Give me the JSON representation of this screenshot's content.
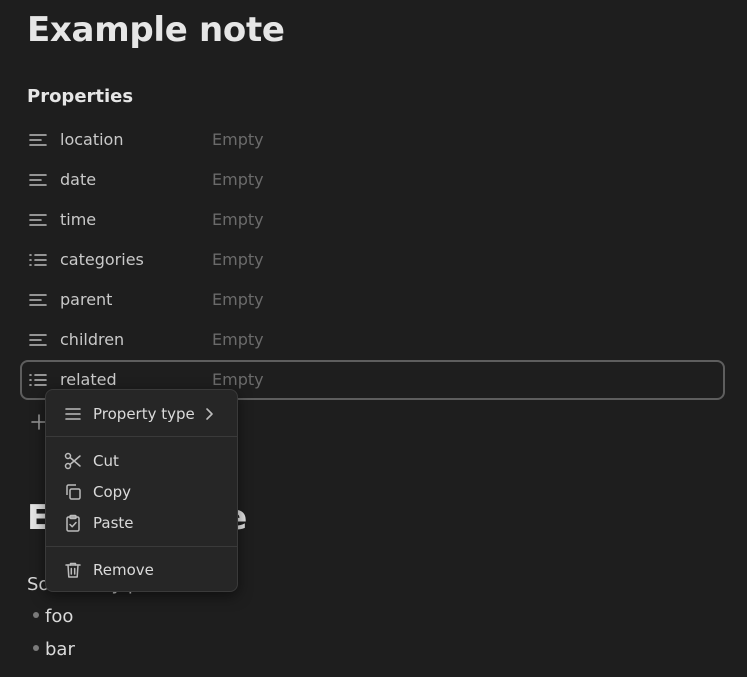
{
  "note": {
    "title": "Example note",
    "heading2_visible": "E",
    "heading2_tail": "e"
  },
  "properties": {
    "heading": "Properties",
    "items": [
      {
        "name": "location",
        "value": "Empty",
        "icon": "text-lines-icon"
      },
      {
        "name": "date",
        "value": "Empty",
        "icon": "text-lines-icon"
      },
      {
        "name": "time",
        "value": "Empty",
        "icon": "text-lines-icon"
      },
      {
        "name": "categories",
        "value": "Empty",
        "icon": "list-icon"
      },
      {
        "name": "parent",
        "value": "Empty",
        "icon": "text-lines-icon"
      },
      {
        "name": "children",
        "value": "Empty",
        "icon": "text-lines-icon"
      },
      {
        "name": "related",
        "value": "Empty",
        "icon": "list-icon"
      }
    ]
  },
  "body": {
    "text_visible": "So",
    "text_tail": "y p",
    "bullets": [
      "foo",
      "bar"
    ]
  },
  "context_menu": {
    "property_type": "Property type",
    "cut": "Cut",
    "copy": "Copy",
    "paste": "Paste",
    "remove": "Remove"
  }
}
